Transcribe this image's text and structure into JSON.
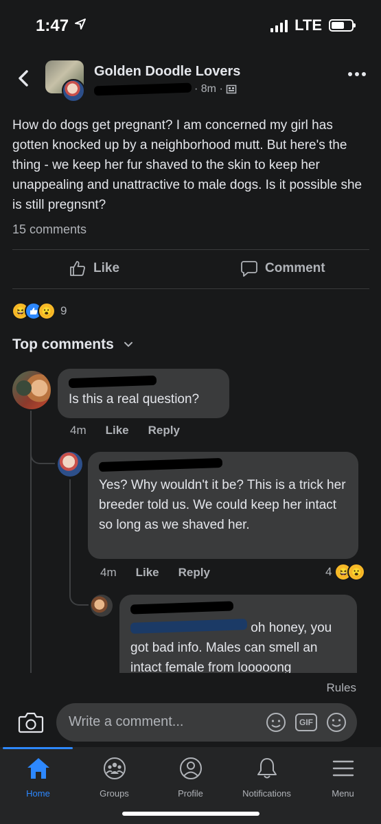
{
  "status": {
    "time": "1:47",
    "carrier": "LTE"
  },
  "header": {
    "group_name": "Golden Doodle Lovers",
    "time_ago": "· 8m ·"
  },
  "post": {
    "text": "How do dogs get pregnant? I am concerned my girl has gotten knocked up by a neighborhood mutt. But here's the thing - we keep her fur shaved to the skin to keep her unappealing and unattractive to male dogs. Is it possible she is still pregnsnt?",
    "comment_count": "15 comments",
    "like_label": "Like",
    "comment_label": "Comment",
    "reaction_count": "9"
  },
  "comments_header": "Top comments",
  "comments": [
    {
      "text": "Is this a real question?",
      "time": "4m",
      "like": "Like",
      "reply": "Reply"
    },
    {
      "text": "Yes? Why wouldn't it be? This is a trick her breeder told us. We could keep her intact so long as we shaved her.",
      "time": "4m",
      "like": "Like",
      "reply": "Reply",
      "reaction_count": "4"
    },
    {
      "text": "oh honey, you got bad info. Males can smell an intact female from looooong"
    }
  ],
  "composer": {
    "rules": "Rules",
    "placeholder": "Write a comment...",
    "gif": "GIF"
  },
  "tabs": [
    {
      "label": "Home"
    },
    {
      "label": "Groups"
    },
    {
      "label": "Profile"
    },
    {
      "label": "Notifications"
    },
    {
      "label": "Menu"
    }
  ],
  "colors": {
    "background": "#18191a",
    "bubble": "#3a3b3c",
    "accent": "#2d88ff",
    "text": "#e4e6eb",
    "muted": "#b0b3b8"
  }
}
